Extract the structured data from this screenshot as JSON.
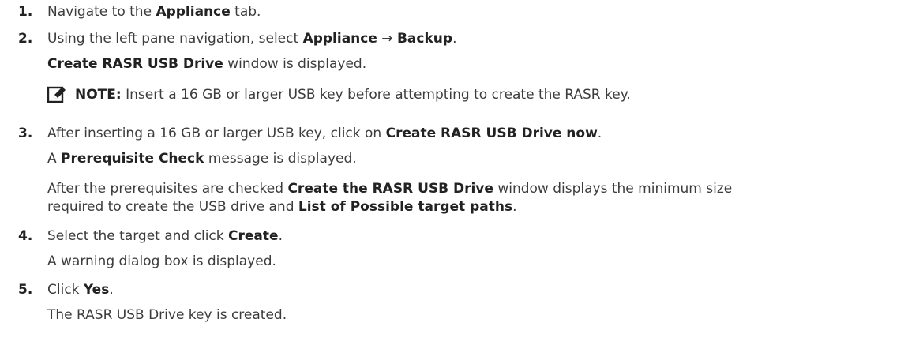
{
  "steps": [
    {
      "number": "1.",
      "line": {
        "pre": "Navigate to the ",
        "b": "Appliance",
        "post": " tab."
      }
    },
    {
      "number": "2.",
      "line": {
        "pre": "Using the left pane navigation, select ",
        "b1": "Appliance",
        "arrow": " → ",
        "b2": "Backup",
        "post": "."
      },
      "result": {
        "b": "Create RASR USB Drive",
        "post": " window is displayed."
      }
    },
    {
      "number": "3.",
      "line": {
        "pre": "After inserting a 16 GB or larger USB key, click on ",
        "b": "Create RASR USB Drive now",
        "post": "."
      },
      "result1": {
        "pre": "A ",
        "b": "Prerequisite Check",
        "post": " message is displayed."
      },
      "result2": {
        "pre": "After the prerequisites are checked ",
        "b1": "Create the RASR USB Drive",
        "mid": " window displays the minimum size",
        "line2_pre": "required to create the USB drive and ",
        "b2": "List of Possible target paths",
        "post": "."
      }
    },
    {
      "number": "4.",
      "line": {
        "pre": "Select the target and click ",
        "b": "Create",
        "post": "."
      },
      "result": "A warning dialog box is displayed."
    },
    {
      "number": "5.",
      "line": {
        "pre": "Click ",
        "b": "Yes",
        "post": "."
      },
      "result": "The RASR USB Drive key is created."
    }
  ],
  "note": {
    "icon": "pencil-note-icon",
    "label": "NOTE:",
    "text": " Insert a 16 GB or larger USB key before attempting to create the RASR key."
  }
}
